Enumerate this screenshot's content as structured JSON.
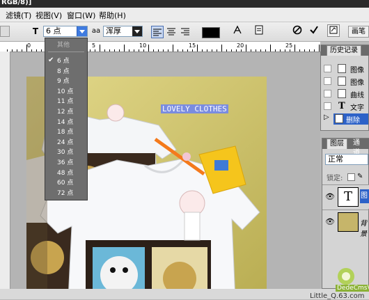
{
  "window": {
    "title_fragment": "RGB/8)]"
  },
  "menu": [
    {
      "label": "滤镜(T)"
    },
    {
      "label": "视图(V)"
    },
    {
      "label": "窗口(W)"
    },
    {
      "label": "帮助(H)"
    }
  ],
  "options": {
    "font_size_value": "6 点",
    "anti_alias_icon": "aa",
    "anti_alias_value": "浑厚",
    "right_label": "画笔"
  },
  "ruler": {
    "labels": [
      "0",
      "5",
      "10",
      "15",
      "20",
      "25"
    ]
  },
  "font_size_menu": {
    "header": "其他",
    "items": [
      "6 点",
      "8 点",
      "9 点",
      "10 点",
      "11 点",
      "12 点",
      "14 点",
      "18 点",
      "24 点",
      "30 点",
      "36 点",
      "48 点",
      "60 点",
      "72 点"
    ],
    "selected": "6 点"
  },
  "canvas": {
    "text_layer": "LOVELY CLOTHES"
  },
  "history": {
    "tab": "历史记录",
    "items": [
      {
        "label": "图像"
      },
      {
        "label": "图像"
      },
      {
        "label": "曲线"
      },
      {
        "label": "文字"
      },
      {
        "label": "删除"
      }
    ]
  },
  "layers": {
    "tab1": "图层",
    "tab2": "通道",
    "blend_mode": "正常",
    "lock_label": "锁定:",
    "layer_text_label": "图",
    "layer_bg_label": "背景"
  },
  "watermark": {
    "line1": "DedeCmsV3",
    "line2": "Little_Q.63.com"
  }
}
